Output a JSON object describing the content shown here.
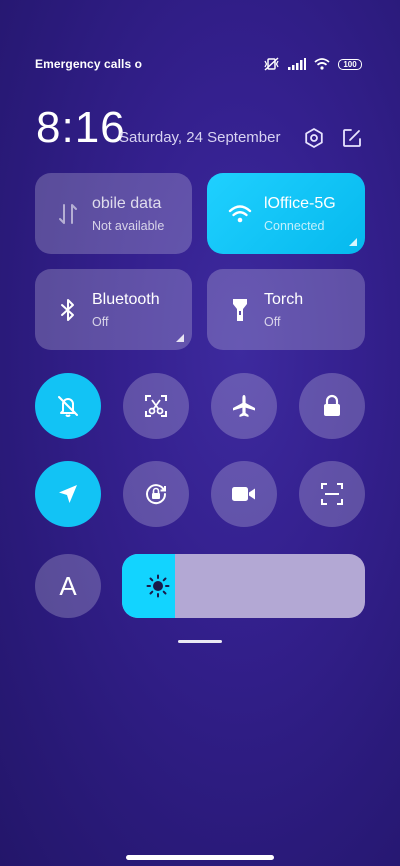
{
  "status_bar": {
    "left_text": "Emergency calls o",
    "battery": "100"
  },
  "header": {
    "time": "8:16",
    "date": "Saturday, 24 September"
  },
  "tiles": [
    {
      "title": "obile data",
      "subtitle": "Not available",
      "icon": "mobile-data-icon"
    },
    {
      "title": "lOffice-5G",
      "subtitle": "Connected",
      "icon": "wifi-icon"
    },
    {
      "title": "Bluetooth",
      "subtitle": "Off",
      "icon": "bluetooth-icon"
    },
    {
      "title": "Torch",
      "subtitle": "Off",
      "icon": "torch-icon"
    }
  ],
  "toggles_row1": [
    "mute-icon",
    "screenshot-icon",
    "airplane-icon",
    "lock-icon"
  ],
  "toggles_row2": [
    "location-icon",
    "rotation-lock-icon",
    "screen-record-icon",
    "scanner-icon"
  ],
  "font_button": {
    "label": "A"
  },
  "brightness": {
    "level": 0.22
  },
  "colors": {
    "accent": "#12c3f5",
    "tile_bg": "rgba(255,255,255,0.22)"
  }
}
